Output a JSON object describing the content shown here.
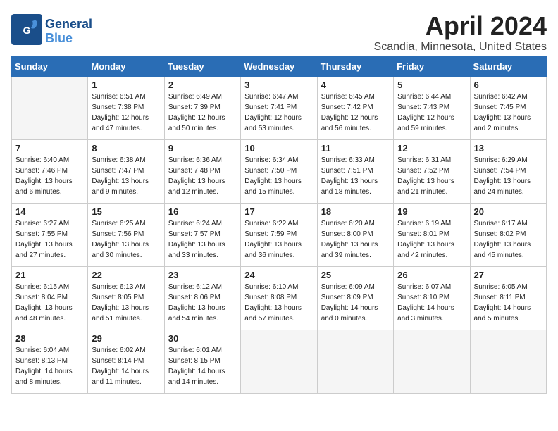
{
  "logo": {
    "name": "General",
    "name2": "Blue"
  },
  "header": {
    "month_year": "April 2024",
    "location": "Scandia, Minnesota, United States"
  },
  "days_of_week": [
    "Sunday",
    "Monday",
    "Tuesday",
    "Wednesday",
    "Thursday",
    "Friday",
    "Saturday"
  ],
  "weeks": [
    [
      {
        "day": "",
        "empty": true
      },
      {
        "day": "1",
        "sunrise": "Sunrise: 6:51 AM",
        "sunset": "Sunset: 7:38 PM",
        "daylight": "Daylight: 12 hours and 47 minutes."
      },
      {
        "day": "2",
        "sunrise": "Sunrise: 6:49 AM",
        "sunset": "Sunset: 7:39 PM",
        "daylight": "Daylight: 12 hours and 50 minutes."
      },
      {
        "day": "3",
        "sunrise": "Sunrise: 6:47 AM",
        "sunset": "Sunset: 7:41 PM",
        "daylight": "Daylight: 12 hours and 53 minutes."
      },
      {
        "day": "4",
        "sunrise": "Sunrise: 6:45 AM",
        "sunset": "Sunset: 7:42 PM",
        "daylight": "Daylight: 12 hours and 56 minutes."
      },
      {
        "day": "5",
        "sunrise": "Sunrise: 6:44 AM",
        "sunset": "Sunset: 7:43 PM",
        "daylight": "Daylight: 12 hours and 59 minutes."
      },
      {
        "day": "6",
        "sunrise": "Sunrise: 6:42 AM",
        "sunset": "Sunset: 7:45 PM",
        "daylight": "Daylight: 13 hours and 2 minutes."
      }
    ],
    [
      {
        "day": "7",
        "sunrise": "Sunrise: 6:40 AM",
        "sunset": "Sunset: 7:46 PM",
        "daylight": "Daylight: 13 hours and 6 minutes."
      },
      {
        "day": "8",
        "sunrise": "Sunrise: 6:38 AM",
        "sunset": "Sunset: 7:47 PM",
        "daylight": "Daylight: 13 hours and 9 minutes."
      },
      {
        "day": "9",
        "sunrise": "Sunrise: 6:36 AM",
        "sunset": "Sunset: 7:48 PM",
        "daylight": "Daylight: 13 hours and 12 minutes."
      },
      {
        "day": "10",
        "sunrise": "Sunrise: 6:34 AM",
        "sunset": "Sunset: 7:50 PM",
        "daylight": "Daylight: 13 hours and 15 minutes."
      },
      {
        "day": "11",
        "sunrise": "Sunrise: 6:33 AM",
        "sunset": "Sunset: 7:51 PM",
        "daylight": "Daylight: 13 hours and 18 minutes."
      },
      {
        "day": "12",
        "sunrise": "Sunrise: 6:31 AM",
        "sunset": "Sunset: 7:52 PM",
        "daylight": "Daylight: 13 hours and 21 minutes."
      },
      {
        "day": "13",
        "sunrise": "Sunrise: 6:29 AM",
        "sunset": "Sunset: 7:54 PM",
        "daylight": "Daylight: 13 hours and 24 minutes."
      }
    ],
    [
      {
        "day": "14",
        "sunrise": "Sunrise: 6:27 AM",
        "sunset": "Sunset: 7:55 PM",
        "daylight": "Daylight: 13 hours and 27 minutes."
      },
      {
        "day": "15",
        "sunrise": "Sunrise: 6:25 AM",
        "sunset": "Sunset: 7:56 PM",
        "daylight": "Daylight: 13 hours and 30 minutes."
      },
      {
        "day": "16",
        "sunrise": "Sunrise: 6:24 AM",
        "sunset": "Sunset: 7:57 PM",
        "daylight": "Daylight: 13 hours and 33 minutes."
      },
      {
        "day": "17",
        "sunrise": "Sunrise: 6:22 AM",
        "sunset": "Sunset: 7:59 PM",
        "daylight": "Daylight: 13 hours and 36 minutes."
      },
      {
        "day": "18",
        "sunrise": "Sunrise: 6:20 AM",
        "sunset": "Sunset: 8:00 PM",
        "daylight": "Daylight: 13 hours and 39 minutes."
      },
      {
        "day": "19",
        "sunrise": "Sunrise: 6:19 AM",
        "sunset": "Sunset: 8:01 PM",
        "daylight": "Daylight: 13 hours and 42 minutes."
      },
      {
        "day": "20",
        "sunrise": "Sunrise: 6:17 AM",
        "sunset": "Sunset: 8:02 PM",
        "daylight": "Daylight: 13 hours and 45 minutes."
      }
    ],
    [
      {
        "day": "21",
        "sunrise": "Sunrise: 6:15 AM",
        "sunset": "Sunset: 8:04 PM",
        "daylight": "Daylight: 13 hours and 48 minutes."
      },
      {
        "day": "22",
        "sunrise": "Sunrise: 6:13 AM",
        "sunset": "Sunset: 8:05 PM",
        "daylight": "Daylight: 13 hours and 51 minutes."
      },
      {
        "day": "23",
        "sunrise": "Sunrise: 6:12 AM",
        "sunset": "Sunset: 8:06 PM",
        "daylight": "Daylight: 13 hours and 54 minutes."
      },
      {
        "day": "24",
        "sunrise": "Sunrise: 6:10 AM",
        "sunset": "Sunset: 8:08 PM",
        "daylight": "Daylight: 13 hours and 57 minutes."
      },
      {
        "day": "25",
        "sunrise": "Sunrise: 6:09 AM",
        "sunset": "Sunset: 8:09 PM",
        "daylight": "Daylight: 14 hours and 0 minutes."
      },
      {
        "day": "26",
        "sunrise": "Sunrise: 6:07 AM",
        "sunset": "Sunset: 8:10 PM",
        "daylight": "Daylight: 14 hours and 3 minutes."
      },
      {
        "day": "27",
        "sunrise": "Sunrise: 6:05 AM",
        "sunset": "Sunset: 8:11 PM",
        "daylight": "Daylight: 14 hours and 5 minutes."
      }
    ],
    [
      {
        "day": "28",
        "sunrise": "Sunrise: 6:04 AM",
        "sunset": "Sunset: 8:13 PM",
        "daylight": "Daylight: 14 hours and 8 minutes."
      },
      {
        "day": "29",
        "sunrise": "Sunrise: 6:02 AM",
        "sunset": "Sunset: 8:14 PM",
        "daylight": "Daylight: 14 hours and 11 minutes."
      },
      {
        "day": "30",
        "sunrise": "Sunrise: 6:01 AM",
        "sunset": "Sunset: 8:15 PM",
        "daylight": "Daylight: 14 hours and 14 minutes."
      },
      {
        "day": "",
        "empty": true
      },
      {
        "day": "",
        "empty": true
      },
      {
        "day": "",
        "empty": true
      },
      {
        "day": "",
        "empty": true
      }
    ]
  ]
}
